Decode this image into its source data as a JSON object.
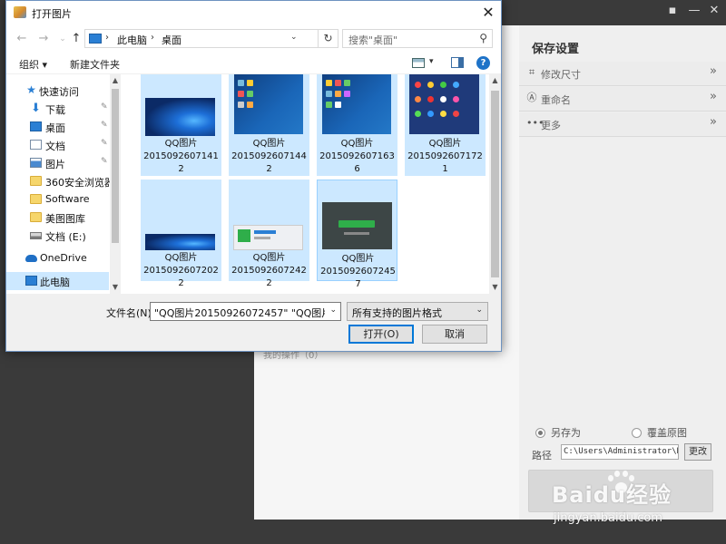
{
  "background_app": {
    "save_settings_title": "保存设置",
    "settings": [
      {
        "label": "修改尺寸",
        "icon": "crop-icon"
      },
      {
        "label": "重命名",
        "icon": "rename-icon"
      },
      {
        "label": "更多",
        "icon": "more-icon"
      }
    ],
    "history_label": "我的操作（0）",
    "save_as_label": "另存为",
    "overwrite_label": "覆盖原图",
    "path_label": "路径",
    "path_value": "C:\\Users\\Administrator\\De:",
    "change_button": "更改"
  },
  "dialog": {
    "title": "打开图片",
    "breadcrumb": [
      "此电脑",
      "桌面"
    ],
    "search_placeholder": "搜索\"桌面\"",
    "toolbar": {
      "organize": "组织 ▾",
      "new_folder": "新建文件夹",
      "help": "?"
    },
    "nav_items": [
      {
        "label": "快速访问",
        "icon": "star-icon",
        "pinned": false
      },
      {
        "label": "下载",
        "icon": "download-icon",
        "pinned": true
      },
      {
        "label": "桌面",
        "icon": "desktop-icon",
        "pinned": true
      },
      {
        "label": "文档",
        "icon": "document-icon",
        "pinned": true
      },
      {
        "label": "图片",
        "icon": "pictures-icon",
        "pinned": true
      },
      {
        "label": "360安全浏览器",
        "icon": "folder-icon",
        "pinned": false
      },
      {
        "label": "Software",
        "icon": "folder-icon",
        "pinned": false
      },
      {
        "label": "美图图库",
        "icon": "folder-icon",
        "pinned": false
      },
      {
        "label": "文档 (E:)",
        "icon": "drive-icon",
        "pinned": false
      },
      {
        "label": "OneDrive",
        "icon": "onedrive-icon",
        "pinned": false
      },
      {
        "label": "此电脑",
        "icon": "pc-icon",
        "pinned": false
      }
    ],
    "files": [
      {
        "name_line1": "QQ图片",
        "name_line2": "2015092607141",
        "name_line3": "2",
        "thumb": "windows-wallpaper"
      },
      {
        "name_line1": "QQ图片",
        "name_line2": "2015092607144",
        "name_line3": "2",
        "thumb": "desktop-screenshot"
      },
      {
        "name_line1": "QQ图片",
        "name_line2": "2015092607163",
        "name_line3": "6",
        "thumb": "desktop-screenshot"
      },
      {
        "name_line1": "QQ图片",
        "name_line2": "2015092607172",
        "name_line3": "1",
        "thumb": "app-icons"
      },
      {
        "name_line1": "QQ图片",
        "name_line2": "2015092607202",
        "name_line3": "2",
        "thumb": "windows-wallpaper"
      },
      {
        "name_line1": "QQ图片",
        "name_line2": "2015092607242",
        "name_line3": "2",
        "thumb": "app-window"
      },
      {
        "name_line1": "QQ图片",
        "name_line2": "2015092607245",
        "name_line3": "7",
        "thumb": "dark-dialog"
      }
    ],
    "filename_label": "文件名(N):",
    "filename_value": "\"QQ图片20150926072457\" \"QQ图片2015",
    "filetype_value": "所有支持的图片格式",
    "open_button": "打开(O)",
    "cancel_button": "取消"
  },
  "watermark": {
    "text": "Baidu经验",
    "url": "jingyan.baidu.com"
  }
}
